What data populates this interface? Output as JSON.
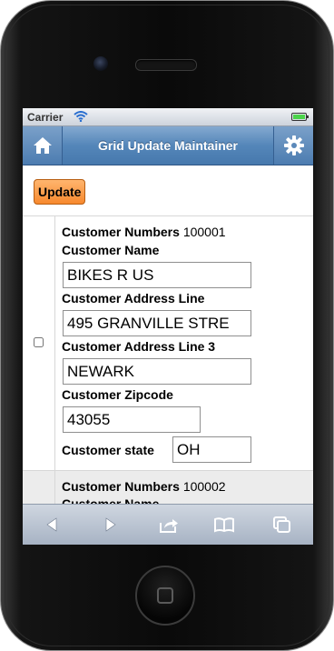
{
  "statusbar": {
    "carrier": "Carrier"
  },
  "header": {
    "title": "Grid Update Maintainer"
  },
  "toolbar": {
    "update_label": "Update"
  },
  "records": [
    {
      "customer_number_label": "Customer Numbers",
      "customer_number": "100001",
      "name_label": "Customer Name",
      "name": "BIKES R US",
      "address_label": "Customer Address Line",
      "address": "495 GRANVILLE STRE",
      "address3_label": "Customer Address Line 3",
      "address3": "NEWARK",
      "zip_label": "Customer Zipcode",
      "zip": "43055",
      "state_label": "Customer state",
      "state": "OH"
    },
    {
      "customer_number_label": "Customer Numbers",
      "customer_number": "100002",
      "name_label": "Customer Name"
    }
  ],
  "browser_toolbar": {
    "icons": [
      "back-icon",
      "forward-icon",
      "share-icon",
      "bookmarks-icon",
      "tabs-icon"
    ]
  },
  "colors": {
    "header": "#5486b9",
    "update_button": "#f7892e",
    "battery": "#4bd34b"
  }
}
